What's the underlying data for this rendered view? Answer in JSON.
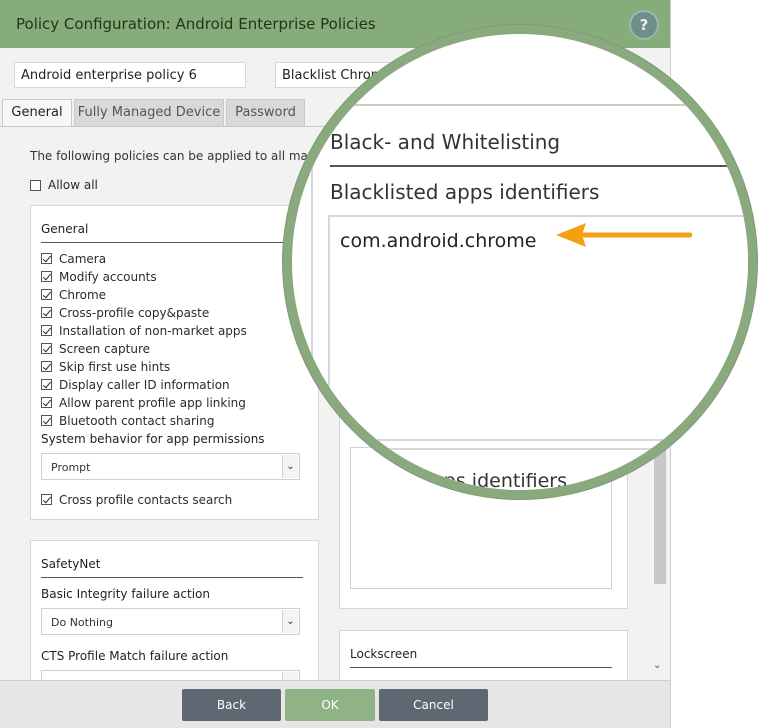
{
  "window": {
    "title": "Policy Configuration: Android Enterprise Policies",
    "help_label": "?"
  },
  "fields": {
    "policy_name": "Android enterprise policy 6",
    "list_type": "Blacklist Chrome"
  },
  "tabs": [
    {
      "label": "General",
      "active": true
    },
    {
      "label": "Fully Managed Device",
      "active": false
    },
    {
      "label": "Password",
      "active": false
    }
  ],
  "intro_text": "The following policies can be applied to all man",
  "allow_all_label": "Allow all",
  "general_panel": {
    "heading": "General",
    "items": [
      {
        "label": "Camera",
        "checked": true
      },
      {
        "label": "Modify accounts",
        "checked": true
      },
      {
        "label": "Chrome",
        "checked": true
      },
      {
        "label": "Cross-profile copy&paste",
        "checked": true
      },
      {
        "label": "Installation of non-market apps",
        "checked": true
      },
      {
        "label": "Screen capture",
        "checked": true
      },
      {
        "label": "Skip first use hints",
        "checked": true
      },
      {
        "label": "Display caller ID information",
        "checked": true
      },
      {
        "label": "Allow parent profile app linking",
        "checked": true
      },
      {
        "label": "Bluetooth contact sharing",
        "checked": true
      }
    ],
    "permissions_label": "System behavior for app permissions",
    "permissions_value": "Prompt",
    "cross_profile_contacts_label": "Cross profile contacts search"
  },
  "safetynet_panel": {
    "heading": "SafetyNet",
    "basic_label": "Basic Integrity failure action",
    "basic_value": "Do Nothing",
    "cts_label": "CTS Profile Match failure action"
  },
  "lockscreen_panel": {
    "heading": "Lockscreen"
  },
  "magnifier": {
    "section_heading": "Black- and Whitelisting",
    "blacklist_label": "Blacklisted apps identifiers",
    "blacklist_value": "com.android.chrome",
    "whitelist_label_partial": "d apps identifiers"
  },
  "buttons": {
    "back": "Back",
    "ok": "OK",
    "cancel": "Cancel"
  },
  "colors": {
    "titlebar": "#86ad79",
    "magnifier_ring": "#8ba97f",
    "arrow": "#f5a011",
    "ok_button": "#8fb387",
    "secondary_button": "#5f6872"
  }
}
